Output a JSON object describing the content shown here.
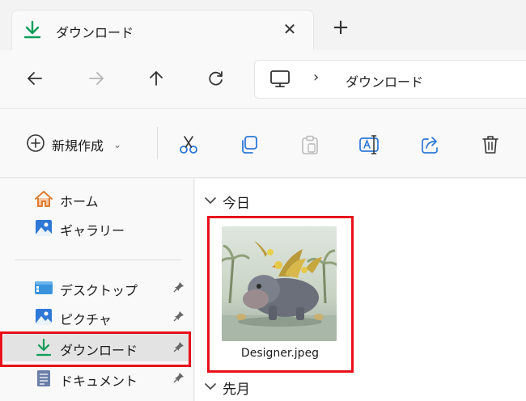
{
  "tab": {
    "title": "ダウンロード",
    "close": "✕",
    "new_tab": "+"
  },
  "nav": {
    "back": "←",
    "forward": "→",
    "up": "↑",
    "refresh": "↻",
    "separator": "›",
    "path": "ダウンロード"
  },
  "command": {
    "new_label": "新規作成",
    "new_chev": "⌄"
  },
  "sidebar": {
    "items": [
      {
        "label": "ホーム",
        "icon": "home-icon",
        "pinned": false
      },
      {
        "label": "ギャラリー",
        "icon": "gallery-icon",
        "pinned": false
      },
      {
        "label": "デスクトップ",
        "icon": "desktop-icon",
        "pinned": true
      },
      {
        "label": "ピクチャ",
        "icon": "pictures-icon",
        "pinned": true
      },
      {
        "label": "ダウンロード",
        "icon": "download-icon",
        "pinned": true,
        "selected": true
      },
      {
        "label": "ドキュメント",
        "icon": "documents-icon",
        "pinned": true
      }
    ]
  },
  "content": {
    "groups": [
      {
        "label": "今日"
      },
      {
        "label": "先月"
      }
    ],
    "files": [
      {
        "name": "Designer.jpeg"
      }
    ]
  },
  "colors": {
    "accent": "#0f9d58",
    "highlight": "#e8101a",
    "folder_blue": "#2f78d8"
  }
}
